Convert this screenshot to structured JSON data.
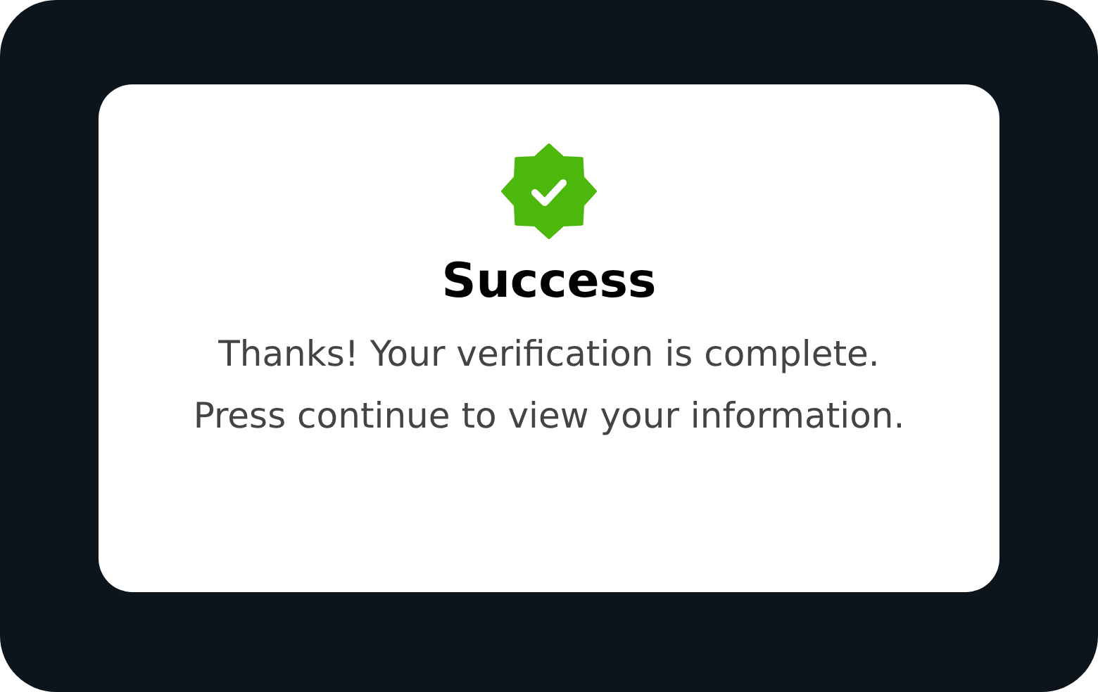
{
  "dialog": {
    "title": "Success",
    "message": "Thanks! Your verification is complete. Press continue to view your information."
  }
}
